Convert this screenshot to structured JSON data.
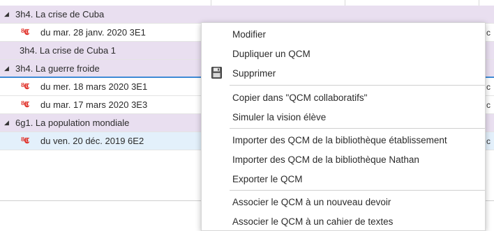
{
  "tree": {
    "rows": [
      {
        "kind": "group",
        "label": "3h4. La crise de Cuba",
        "expanded": true
      },
      {
        "kind": "item",
        "icon": "qcm-icon",
        "label": "du mar. 28 janv. 2020  3E1"
      },
      {
        "kind": "group",
        "label": "3h4. La crise de Cuba 1",
        "expanded": false
      },
      {
        "kind": "group",
        "label": "3h4. La guerre froide",
        "expanded": true
      },
      {
        "kind": "item",
        "icon": "qcm-icon",
        "label": "du mer. 18 mars 2020  3E1"
      },
      {
        "kind": "item",
        "icon": "qcm-icon",
        "label": "du mar. 17 mars 2020  3E3"
      },
      {
        "kind": "group",
        "label": "6g1. La population mondiale",
        "expanded": true
      },
      {
        "kind": "item",
        "icon": "qcm-icon",
        "label": "du ven. 20 déc. 2019  6E2",
        "selected": true
      }
    ],
    "triangle_glyph": "◢",
    "qcm_glyph": "ᴽ𝕮",
    "right_edge_chars": [
      "c",
      "c",
      "c",
      "c"
    ]
  },
  "context_menu": {
    "items": [
      {
        "label": "Modifier"
      },
      {
        "label": "Dupliquer un QCM"
      },
      {
        "label": "Supprimer",
        "icon": "floppy-disk-icon"
      },
      {
        "label": "Copier dans \"QCM collaboratifs\""
      },
      {
        "label": "Simuler la vision élève"
      },
      {
        "label": "Importer des QCM de la bibliothèque établissement"
      },
      {
        "label": "Importer des QCM de la bibliothèque Nathan"
      },
      {
        "label": "Exporter le QCM"
      },
      {
        "label": "Associer le QCM à un nouveau devoir"
      },
      {
        "label": "Associer le QCM à un cahier de textes"
      }
    ]
  },
  "colors": {
    "group_bg": "#e9dff0",
    "selected_bg": "#e3f0fb",
    "accent_line": "#3d8ad6",
    "qcm_icon": "#e0322a"
  }
}
